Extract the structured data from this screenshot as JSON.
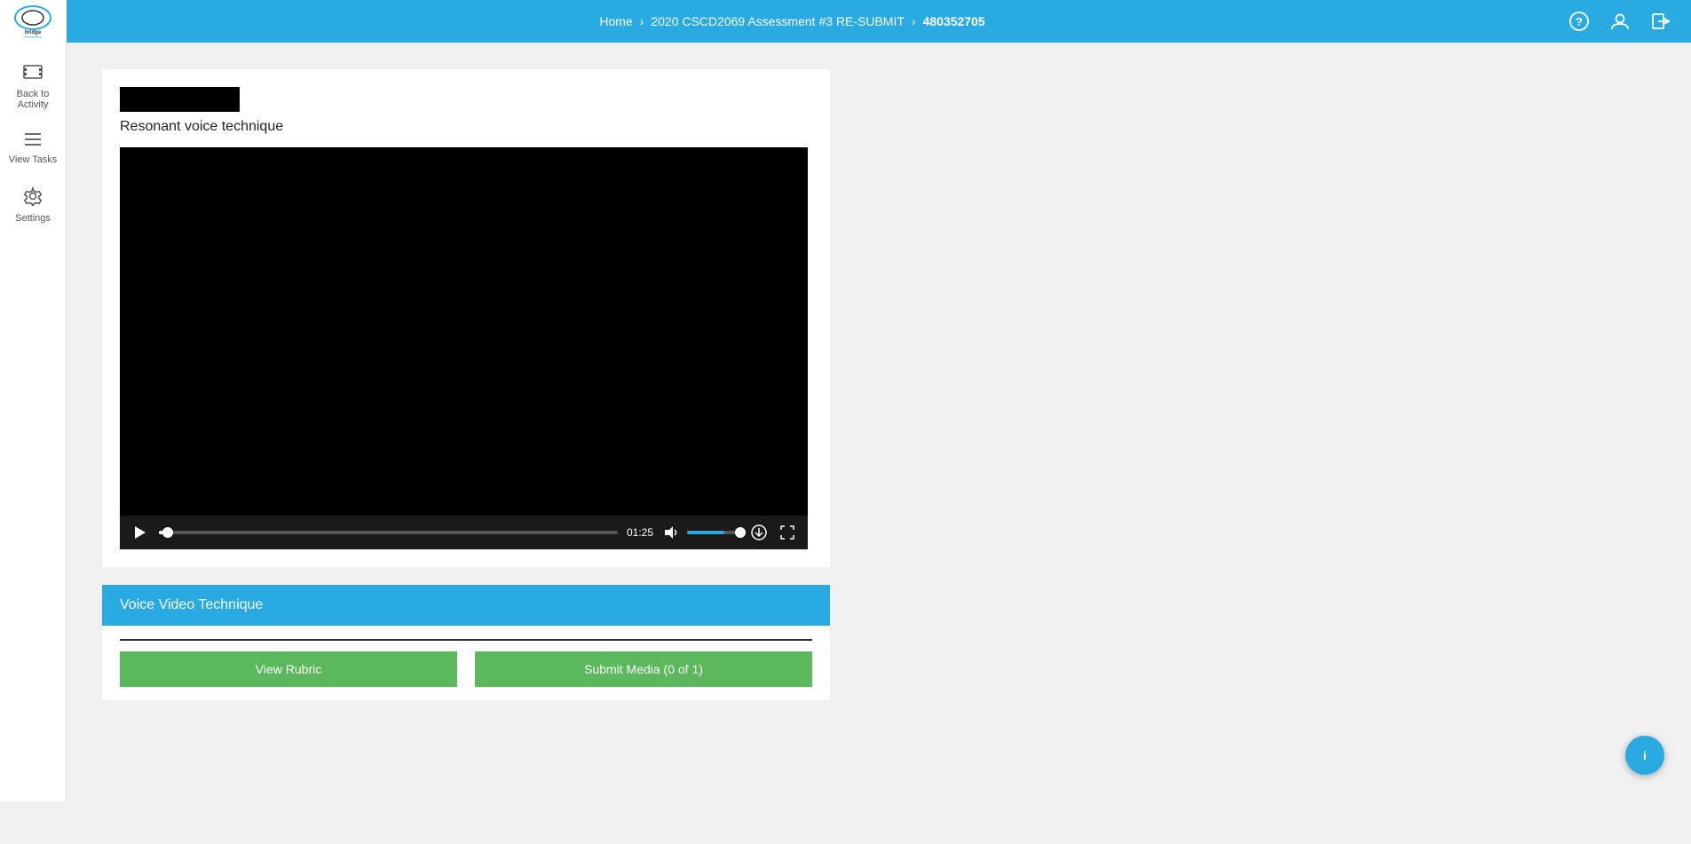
{
  "header": {
    "breadcrumb": {
      "home": "Home",
      "sep1": "›",
      "course": "2020 CSCD2069 Assessment #3 RE-SUBMIT",
      "sep2": "›",
      "id": "480352705"
    }
  },
  "sidebar": {
    "items": [
      {
        "id": "back-to-activity",
        "label": "Back to\nActivity",
        "icon": "film"
      },
      {
        "id": "view-tasks",
        "label": "View Tasks",
        "icon": "list"
      },
      {
        "id": "settings",
        "label": "Settings",
        "icon": "gear"
      }
    ]
  },
  "main": {
    "video": {
      "title": "Resonant voice technique",
      "time": "01:25",
      "progress_pct": 2,
      "volume_pct": 70
    },
    "vvt": {
      "header": "Voice Video Technique",
      "btn1": "View Rubric",
      "btn2": "Submit Media (0 of 1)"
    }
  },
  "nav_icons": {
    "help": "?",
    "user": "👤",
    "logout": "⎋"
  },
  "fab": {
    "icon": "ℹ"
  },
  "colors": {
    "accent": "#29ABE2",
    "green": "#5cb85c",
    "black": "#000000"
  }
}
